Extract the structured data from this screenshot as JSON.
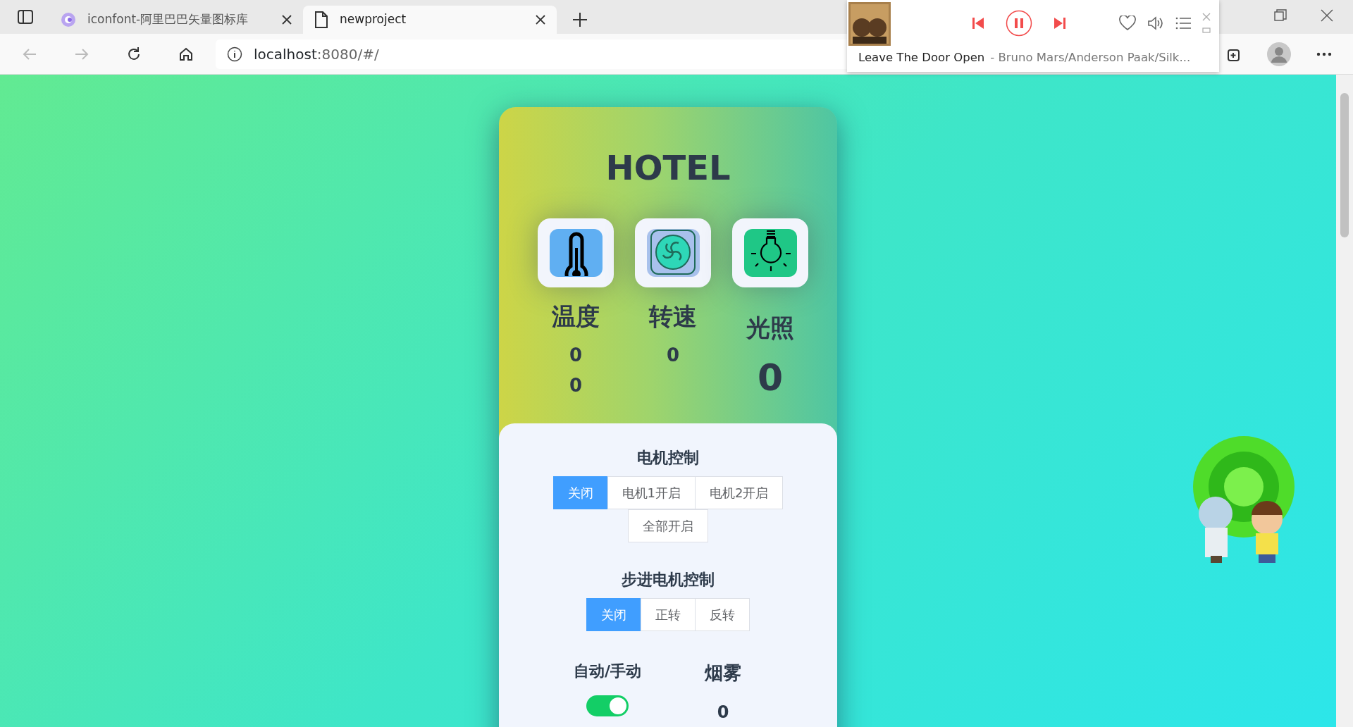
{
  "browser": {
    "tabs": [
      {
        "kind": "iconfont",
        "title": "iconfont-阿里巴巴矢量图标库",
        "selected": false
      },
      {
        "kind": "page",
        "title": "newproject",
        "selected": true
      }
    ],
    "address": {
      "host": "localhost",
      "path": ":8080/#/"
    }
  },
  "player": {
    "song": "Leave The Door Open",
    "artist": "- Bruno Mars/Anderson Paak/Silk...",
    "playing": true
  },
  "card": {
    "title": "HOTEL",
    "sensors": [
      {
        "kind": "temperature",
        "label": "温度",
        "values": [
          "0",
          "0"
        ]
      },
      {
        "kind": "fan",
        "label": "转速",
        "values": [
          "0"
        ]
      },
      {
        "kind": "light",
        "label": "光照",
        "values": [
          "0"
        ]
      }
    ],
    "motor": {
      "title": "电机控制",
      "options": [
        {
          "label": "关闭",
          "selected": true
        },
        {
          "label": "电机1开启",
          "selected": false
        },
        {
          "label": "电机2开启",
          "selected": false
        },
        {
          "label": "全部开启",
          "selected": false
        }
      ]
    },
    "stepper": {
      "title": "步进电机控制",
      "options": [
        {
          "label": "关闭",
          "selected": true
        },
        {
          "label": "正转",
          "selected": false
        },
        {
          "label": "反转",
          "selected": false
        }
      ]
    },
    "auto": {
      "label": "自动/手动",
      "on": true
    },
    "smoke": {
      "label": "烟雾",
      "value": "0"
    }
  }
}
